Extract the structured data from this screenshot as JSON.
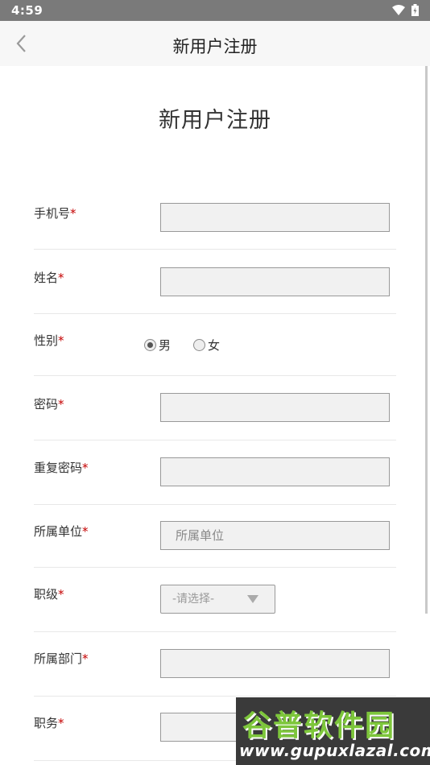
{
  "status_bar": {
    "time": "4:59"
  },
  "app_bar": {
    "title": "新用户注册"
  },
  "page": {
    "heading": "新用户注册"
  },
  "form": {
    "required_mark": "*",
    "phone": {
      "label": "手机号",
      "value": ""
    },
    "name": {
      "label": "姓名",
      "value": ""
    },
    "gender": {
      "label": "性别",
      "options": [
        "男",
        "女"
      ],
      "selected": "男"
    },
    "password": {
      "label": "密码",
      "value": ""
    },
    "confirm_password": {
      "label": "重复密码",
      "value": ""
    },
    "unit": {
      "label": "所属单位",
      "placeholder": "所属单位"
    },
    "rank": {
      "label": "职级",
      "selected": "-请选择-"
    },
    "department": {
      "label": "所属部门",
      "value": ""
    },
    "position": {
      "label": "职务",
      "value": ""
    }
  },
  "watermark": {
    "logo_text": "谷普软件园",
    "url": "www.gupuxlazal.com"
  },
  "colors": {
    "required": "#c40000",
    "status_bar": "#7a7a7a",
    "input_bg": "#f1f1f1",
    "watermark_green": "#7dc63b"
  }
}
